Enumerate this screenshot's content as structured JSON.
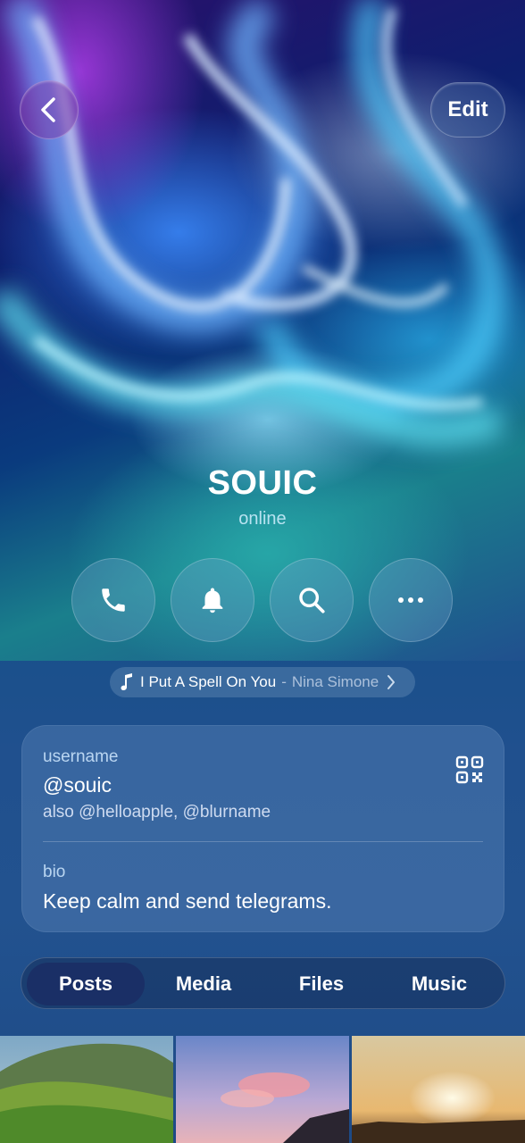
{
  "header": {
    "edit_label": "Edit"
  },
  "profile": {
    "name": "SOUIC",
    "status": "online"
  },
  "actions": [
    {
      "name": "call",
      "icon": "phone-icon"
    },
    {
      "name": "mute",
      "icon": "bell-icon"
    },
    {
      "name": "search",
      "icon": "search-icon"
    },
    {
      "name": "more",
      "icon": "more-icon"
    }
  ],
  "music": {
    "title": "I Put A Spell On You",
    "separator": "-",
    "artist": "Nina Simone"
  },
  "info": {
    "username_label": "username",
    "username": "@souic",
    "also": "also @helloapple, @blurname",
    "bio_label": "bio",
    "bio": "Keep calm and send telegrams."
  },
  "tabs": [
    {
      "label": "Posts",
      "active": true
    },
    {
      "label": "Media",
      "active": false
    },
    {
      "label": "Files",
      "active": false
    },
    {
      "label": "Music",
      "active": false
    }
  ],
  "colors": {
    "accent_tab": "#1a2f66",
    "background": "#20508e"
  }
}
